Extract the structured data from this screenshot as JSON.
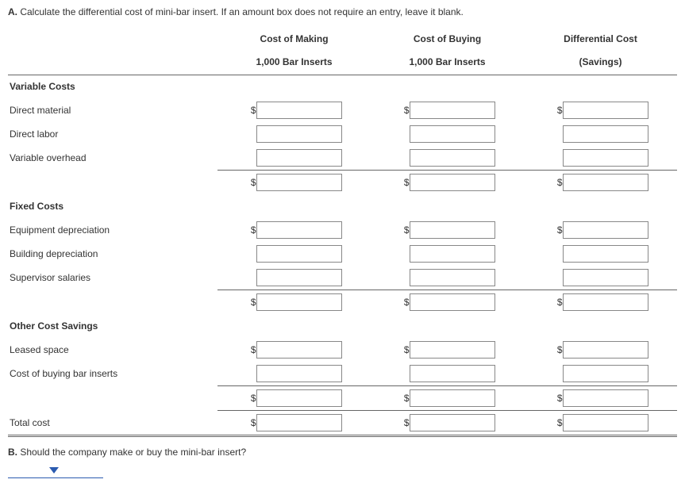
{
  "prompt_a": {
    "label": "A.",
    "text": " Calculate the differential cost of mini-bar insert. If an amount box does not require an entry, leave it blank."
  },
  "columns": {
    "c1_l1": "Cost of Making",
    "c1_l2": "1,000 Bar Inserts",
    "c2_l1": "Cost of Buying",
    "c2_l2": "1,000 Bar Inserts",
    "c3_l1": "Differential Cost",
    "c3_l2": "(Savings)"
  },
  "sections": {
    "variable": {
      "title": "Variable Costs",
      "rows": [
        "Direct material",
        "Direct labor",
        "Variable overhead"
      ]
    },
    "fixed": {
      "title": "Fixed Costs",
      "rows": [
        "Equipment depreciation",
        "Building depreciation",
        "Supervisor salaries"
      ]
    },
    "other": {
      "title": "Other Cost Savings",
      "rows": [
        "Leased space",
        "Cost of buying bar inserts"
      ]
    }
  },
  "total_label": "Total cost",
  "currency": "$",
  "prompt_b": {
    "label": "B.",
    "text": " Should the company make or buy the mini-bar insert?"
  }
}
